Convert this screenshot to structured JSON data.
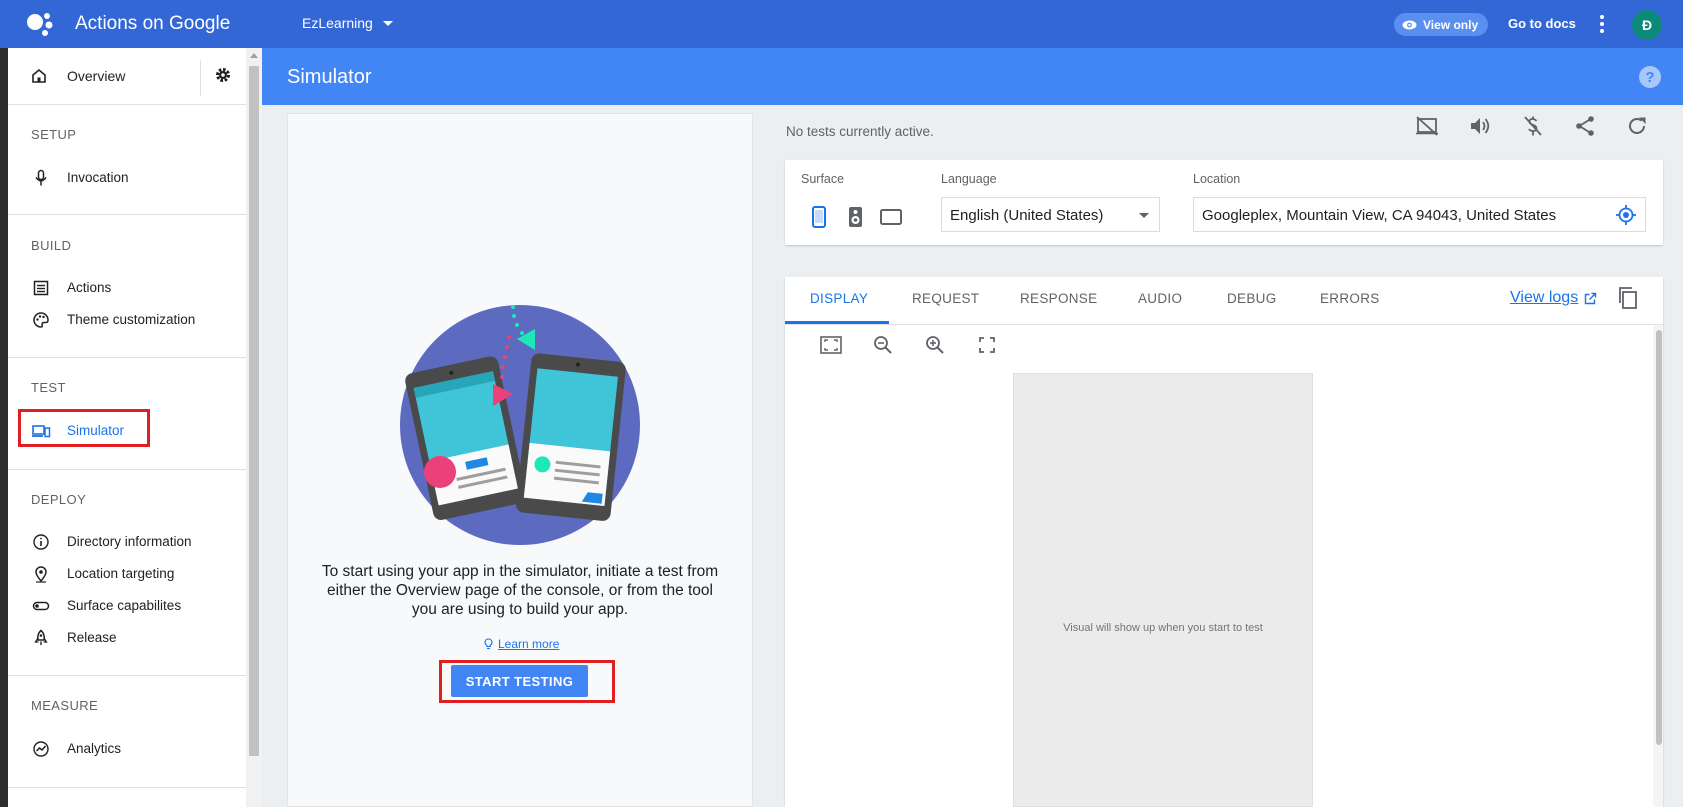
{
  "app": {
    "title": "Actions on Google",
    "project": "EzLearning"
  },
  "topbar": {
    "view_only": "View only",
    "docs": "Go to docs",
    "avatar_letter": "Đ"
  },
  "sidebar": {
    "overview": "Overview",
    "sections": {
      "setup": "SETUP",
      "build": "BUILD",
      "test": "TEST",
      "deploy": "DEPLOY",
      "measure": "MEASURE"
    },
    "items": {
      "invocation": "Invocation",
      "actions": "Actions",
      "theme": "Theme customization",
      "simulator": "Simulator",
      "directory": "Directory information",
      "location": "Location targeting",
      "surface": "Surface capabilites",
      "release": "Release",
      "analytics": "Analytics"
    }
  },
  "header": {
    "title": "Simulator",
    "help": "?"
  },
  "left_panel": {
    "intro": "To start using your app in the simulator, initiate a test from either the Overview page of the console, or from the tool you are using to build your app.",
    "learn_more": "Learn more",
    "start_button": "START TESTING"
  },
  "status": {
    "no_tests": "No tests currently active."
  },
  "settings": {
    "surface_label": "Surface",
    "language_label": "Language",
    "language_value": "English (United States)",
    "location_label": "Location",
    "location_value": "Googleplex, Mountain View, CA 94043, United States"
  },
  "tabs": {
    "display": "DISPLAY",
    "request": "REQUEST",
    "response": "RESPONSE",
    "audio": "AUDIO",
    "debug": "DEBUG",
    "errors": "ERRORS",
    "view_logs": "View logs"
  },
  "display": {
    "placeholder": "Visual will show up when you start to test"
  },
  "colors": {
    "topbar": "#3367d6",
    "header": "#4285f4",
    "accent": "#1a73e8",
    "highlight": "#e02020",
    "avatar": "#0b8a78"
  }
}
